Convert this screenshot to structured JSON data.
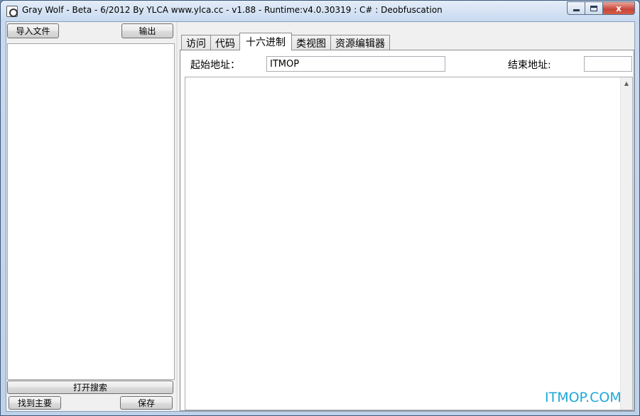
{
  "window": {
    "title": "Gray Wolf - Beta - 6/2012  By YLCA  www.ylca.cc - v1.88 - Runtime:v4.0.30319 : C# : Deobfuscation",
    "close_label": "x"
  },
  "left": {
    "import_label": "导入文件",
    "export_label": "输出",
    "open_search_label": "打开搜索",
    "find_main_label": "找到主要",
    "save_label": "保存"
  },
  "tabs": [
    {
      "label": "访问"
    },
    {
      "label": "代码"
    },
    {
      "label": "十六进制"
    },
    {
      "label": "类视图"
    },
    {
      "label": "资源编辑器"
    }
  ],
  "active_tab": "十六进制",
  "hex": {
    "start_label": "起始地址：",
    "start_value": "ITMOP",
    "end_label": "结束地址:",
    "end_value": ""
  },
  "watermark": "ITMOP.COM",
  "icons": {
    "scroll_up": "▲"
  },
  "colors": {
    "watermark": "#1fa8d8",
    "close_button": "#c8453a"
  }
}
